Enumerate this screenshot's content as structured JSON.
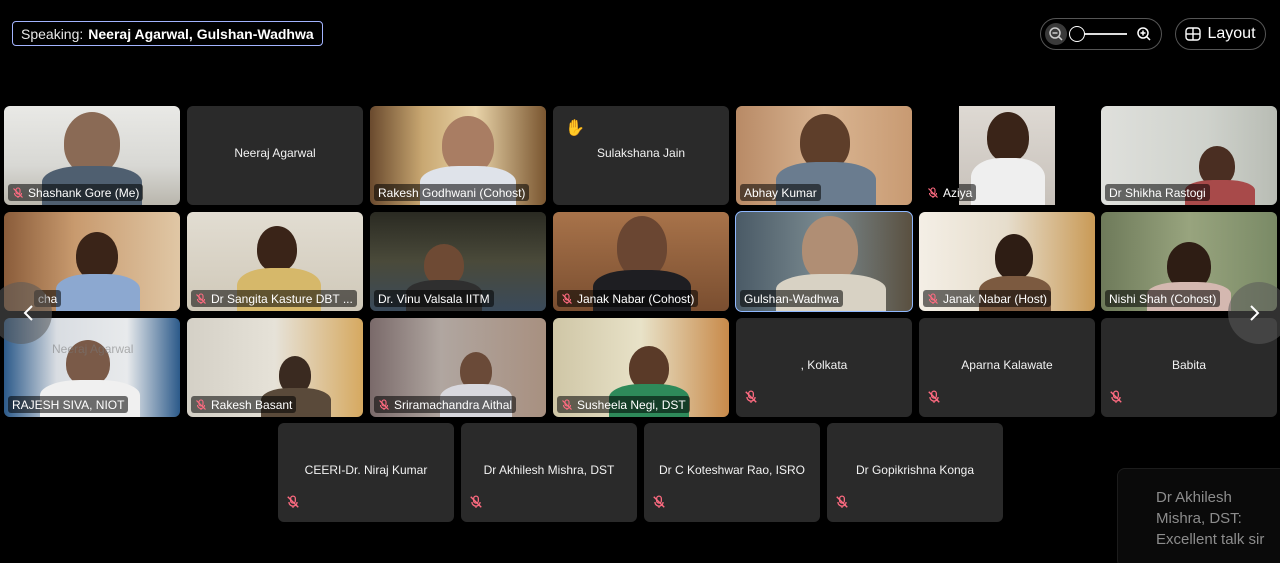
{
  "header": {
    "speaking_label": "Speaking:",
    "speaking_names": "Neeraj Agarwal, Gulshan-Wadhwa",
    "layout_label": "Layout"
  },
  "participants": [
    {
      "name": "Shashank Gore (Me)",
      "muted": true,
      "video": true
    },
    {
      "name": "Neeraj Agarwal",
      "muted": false,
      "video": false
    },
    {
      "name": "Rakesh Godhwani (Cohost)",
      "muted": false,
      "video": true
    },
    {
      "name": "Sulakshana Jain",
      "muted": false,
      "video": false,
      "hand_raised": true
    },
    {
      "name": "Abhay Kumar",
      "muted": false,
      "video": true
    },
    {
      "name": "Aziya",
      "muted": true,
      "video": true
    },
    {
      "name": "Dr Shikha Rastogi",
      "muted": false,
      "video": true
    },
    {
      "name": "cha",
      "muted": false,
      "video": true
    },
    {
      "name": "Dr Sangita Kasture DBT ...",
      "muted": true,
      "video": true
    },
    {
      "name": "Dr. Vinu Valsala IITM",
      "muted": false,
      "video": true
    },
    {
      "name": "Janak Nabar (Cohost)",
      "muted": true,
      "video": true
    },
    {
      "name": "Gulshan-Wadhwa",
      "muted": false,
      "video": true,
      "active_speaker": true
    },
    {
      "name": "Janak Nabar (Host)",
      "muted": true,
      "video": true
    },
    {
      "name": "Nishi Shah (Cohost)",
      "muted": false,
      "video": true
    },
    {
      "name": "RAJESH SIVA, NIOT",
      "muted": false,
      "video": true
    },
    {
      "name": "Rakesh Basant",
      "muted": true,
      "video": true
    },
    {
      "name": "Sriramachandra Aithal",
      "muted": true,
      "video": true
    },
    {
      "name": "Susheela Negi, DST",
      "muted": true,
      "video": true
    },
    {
      "name": ", Kolkata",
      "muted": true,
      "video": false
    },
    {
      "name": "Aparna Kalawate",
      "muted": true,
      "video": false
    },
    {
      "name": "Babita",
      "muted": true,
      "video": false
    },
    {
      "name": "CEERI-Dr. Niraj Kumar",
      "muted": true,
      "video": false
    },
    {
      "name": "Dr Akhilesh Mishra, DST",
      "muted": true,
      "video": false
    },
    {
      "name": "Dr C Koteshwar Rao, ISRO",
      "muted": true,
      "video": false
    },
    {
      "name": "Dr Gopikrishna Konga",
      "muted": true,
      "video": false
    }
  ],
  "watermark_text": "Neeraj Agarwal",
  "chat_toast": {
    "text": "Dr Akhilesh Mishra, DST: Excellent talk sir"
  },
  "colors": {
    "speaker_border": "#a3b4ff",
    "active_tile_outline": "#8fb8ff",
    "muted_icon": "#ff6b81",
    "hand_icon": "#f5b400"
  }
}
